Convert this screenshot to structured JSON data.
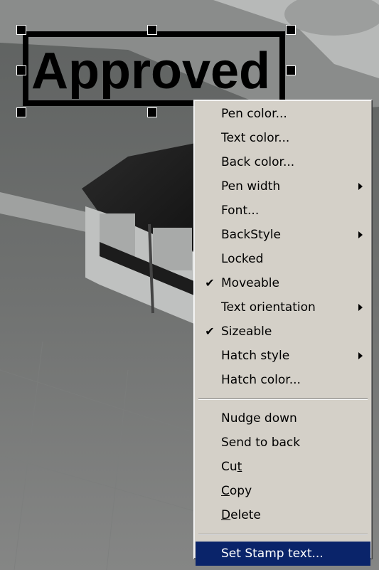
{
  "stamp": {
    "text": "Approved"
  },
  "context_menu": {
    "items": [
      {
        "label": "Pen color...",
        "checked": false,
        "submenu": false
      },
      {
        "label": "Text color...",
        "checked": false,
        "submenu": false
      },
      {
        "label": "Back color...",
        "checked": false,
        "submenu": false
      },
      {
        "label": "Pen width",
        "checked": false,
        "submenu": true
      },
      {
        "label": "Font...",
        "checked": false,
        "submenu": false
      },
      {
        "label": "BackStyle",
        "checked": false,
        "submenu": true
      },
      {
        "label": "Locked",
        "checked": false,
        "submenu": false
      },
      {
        "label": "Moveable",
        "checked": true,
        "submenu": false
      },
      {
        "label": "Text orientation",
        "checked": false,
        "submenu": true
      },
      {
        "label": "Sizeable",
        "checked": true,
        "submenu": false
      },
      {
        "label": "Hatch style",
        "checked": false,
        "submenu": true
      },
      {
        "label": "Hatch color...",
        "checked": false,
        "submenu": false
      },
      {
        "label": "Nudge down",
        "checked": false,
        "submenu": false
      },
      {
        "label": "Send to back",
        "checked": false,
        "submenu": false
      },
      {
        "label": "Cut",
        "checked": false,
        "submenu": false,
        "mnemonic_index": 2
      },
      {
        "label": "Copy",
        "checked": false,
        "submenu": false,
        "mnemonic_index": 0
      },
      {
        "label": "Delete",
        "checked": false,
        "submenu": false,
        "mnemonic_index": 0
      },
      {
        "label": "Set Stamp text...",
        "checked": false,
        "submenu": false,
        "selected": true
      }
    ],
    "check_glyph": "✔",
    "selection_color": "#0a246a"
  }
}
